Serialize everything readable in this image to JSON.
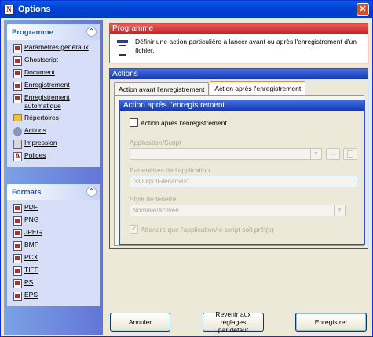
{
  "window": {
    "title": "Options",
    "close_glyph": "✕",
    "app_icon_letter": "N"
  },
  "sidebar": {
    "programme": {
      "header": "Programme",
      "chevron": "⌃",
      "items": [
        {
          "label": "Paramètres généraux",
          "icon": "document-icon"
        },
        {
          "label": "Ghostscript",
          "icon": "document-icon"
        },
        {
          "label": "Document",
          "icon": "document-icon"
        },
        {
          "label": "Enregistrement",
          "icon": "document-icon"
        },
        {
          "label": "Enregistrement automatique",
          "icon": "save-icon"
        },
        {
          "label": "Répertoires",
          "icon": "folder-icon"
        },
        {
          "label": "Actions",
          "icon": "gear-icon"
        },
        {
          "label": "Impression",
          "icon": "printer-icon"
        },
        {
          "label": "Polices",
          "icon": "font-icon"
        }
      ]
    },
    "formats": {
      "header": "Formats",
      "chevron": "⌃",
      "items": [
        {
          "label": "PDF"
        },
        {
          "label": "PNG"
        },
        {
          "label": "JPEG"
        },
        {
          "label": "BMP"
        },
        {
          "label": "PCX"
        },
        {
          "label": "TIFF"
        },
        {
          "label": "PS"
        },
        {
          "label": "EPS"
        }
      ]
    }
  },
  "programme_panel": {
    "title": "Programme",
    "description": "Définir une action particulière à lancer avant ou après l'enregistrement d'un fichier."
  },
  "actions_panel": {
    "title": "Actions",
    "tabs": [
      {
        "label": "Action avant l'enregistrement",
        "active": false
      },
      {
        "label": "Action après l'enregistrement",
        "active": true
      }
    ],
    "sub": {
      "title": "Action après l'enregistrement",
      "enable_checkbox": {
        "label": "Action après l'enregistrement",
        "checked": false
      },
      "app_label": "Application/Script",
      "app_value": "",
      "browse_label": "...",
      "params_label": "Paramètres de l'application",
      "params_value": "\"<OutputFilename>\"",
      "style_label": "Style de fenêtre",
      "style_value": "Normale/Activée",
      "wait_checkbox": {
        "label": "Attendre que l'application/le script soit prêt(e)",
        "checked": true,
        "glyph": "✓"
      }
    }
  },
  "buttons": {
    "cancel": "Annuler",
    "reset_line1": "Revenir aux réglages",
    "reset_line2": "par défaut",
    "save": "Enregistrer"
  },
  "colors": {
    "titlebar": "#0042d6",
    "programme_header": "#c02020",
    "actions_header": "#1838b0",
    "close": "#e04a1f"
  }
}
